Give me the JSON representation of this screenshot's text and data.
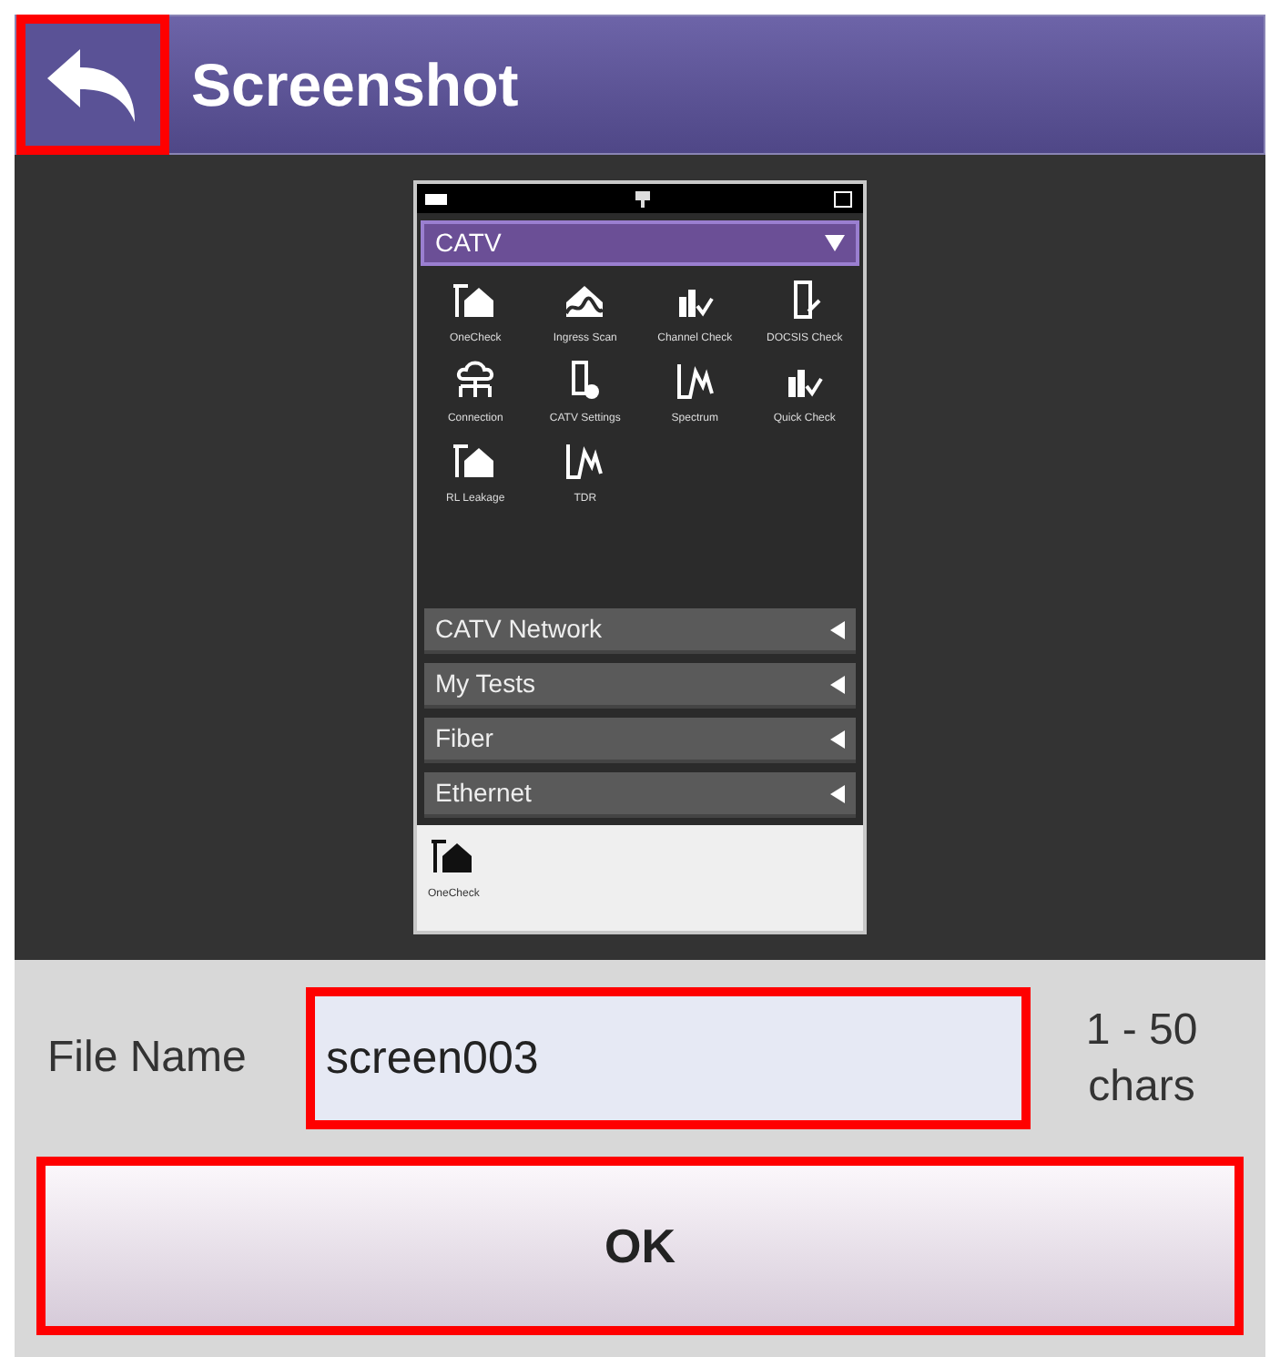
{
  "header": {
    "title": "Screenshot",
    "back_highlighted": true
  },
  "preview": {
    "dropdown": "CATV",
    "apps": [
      {
        "label": "OneCheck",
        "kind": "house"
      },
      {
        "label": "Ingress Scan",
        "kind": "wave"
      },
      {
        "label": "Channel Check",
        "kind": "bars"
      },
      {
        "label": "DOCSIS Check",
        "kind": "modem"
      },
      {
        "label": "Connection",
        "kind": "cloud"
      },
      {
        "label": "CATV Settings",
        "kind": "gear"
      },
      {
        "label": "Spectrum",
        "kind": "spectrum"
      },
      {
        "label": "Quick Check",
        "kind": "bars"
      },
      {
        "label": "RL Leakage",
        "kind": "house"
      },
      {
        "label": "TDR",
        "kind": "spectrum"
      }
    ],
    "groups": [
      "CATV Network",
      "My Tests",
      "Fiber",
      "Ethernet"
    ],
    "favorites": [
      {
        "label": "OneCheck",
        "kind": "house"
      }
    ]
  },
  "file_name": {
    "label": "File Name",
    "value": "screen003",
    "limit": "1 - 50 chars",
    "highlighted": true
  },
  "ok": {
    "label": "OK",
    "highlighted": true
  }
}
